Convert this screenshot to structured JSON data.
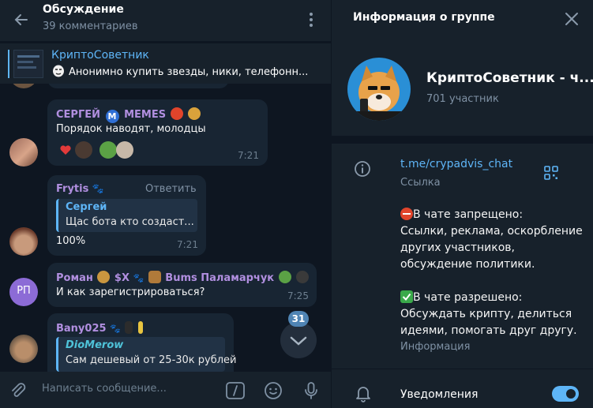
{
  "chat": {
    "title": "Обсуждение",
    "subtitle": "39 комментариев"
  },
  "pinned": {
    "title": "КриптоСоветник",
    "text": "Анонимно купить звезды, ники, телефонн..."
  },
  "messages": [
    {
      "author": "СЕРГЕЙ",
      "author_suffix": "MEMES",
      "text": "Порядок наводят, молодцы",
      "time": "7:21"
    },
    {
      "author": "Frytis",
      "reply_label": "Ответить",
      "quote_name": "Сергей",
      "quote_text": "Щас бота кто создаст...",
      "text": "100%",
      "time": "7:21"
    },
    {
      "author": "Роман",
      "author_mid": "$X",
      "author_tail": "Bums Паламарчук",
      "avatar_initials": "РП",
      "text": "И как зарегистрироваться?",
      "time": "7:25"
    },
    {
      "author": "Bany025",
      "quote_name": "DioMerow",
      "quote_text": "Сам дешевый от 25-30к рублей"
    }
  ],
  "unread_count": "31",
  "composer": {
    "placeholder": "Написать сообщение..."
  },
  "group_info": {
    "panel_title": "Информация о группе",
    "name": "КриптоСоветник - ч...",
    "members": "701 участник",
    "link": "t.me/crypadvis_chat",
    "link_label": "Ссылка",
    "description_lines": [
      "В чате запрещено:",
      "Ссылки, реклама, оскорбление",
      "других участников,",
      "обсуждение политики.",
      "",
      "В чате разрешено:",
      "Обсуждать крипту, делиться",
      "идеями, помогать друг другу."
    ],
    "description_label": "Информация",
    "notifications_label": "Уведомления",
    "notifications_on": true
  },
  "colors": {
    "accent": "#5eb5f7",
    "chat_bg": "#0e1621",
    "panel_bg": "#17212b",
    "bubble_bg": "#182533",
    "name_purple": "#b18fe0",
    "secondary_text": "#7f91a4"
  },
  "icons": {
    "back": "arrow-left-icon",
    "menu": "kebab-icon",
    "close": "close-icon",
    "info": "info-icon",
    "qr": "qr-code-icon",
    "bell": "bell-icon",
    "attach": "paperclip-icon",
    "commands": "slash-command-icon",
    "emoji": "emoji-icon",
    "mic": "microphone-icon",
    "scroll": "chevron-down-icon"
  }
}
